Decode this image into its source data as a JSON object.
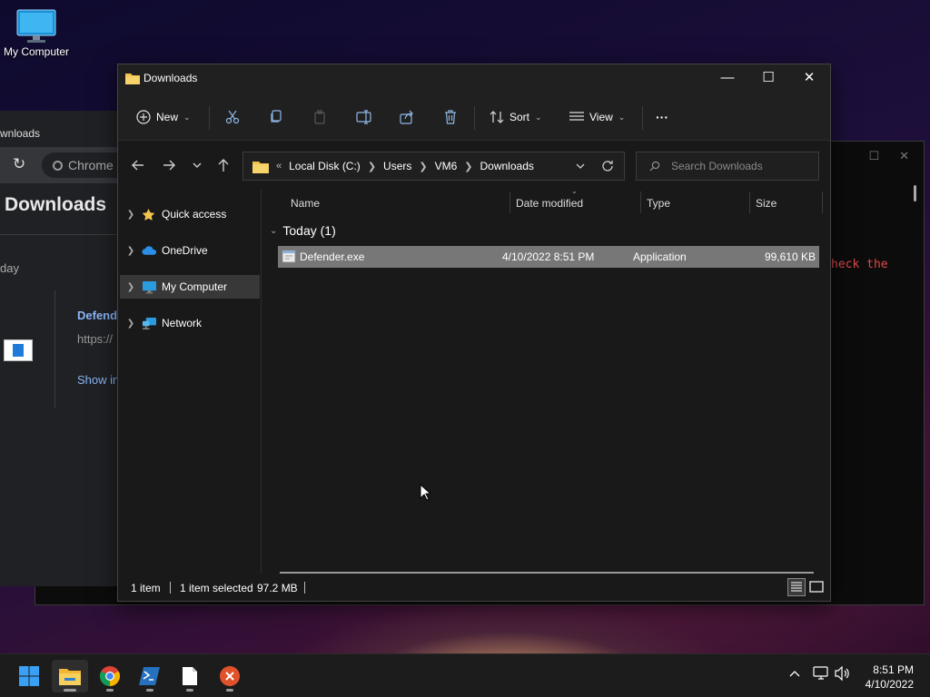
{
  "desktop": {
    "icon_label": "My Computer"
  },
  "terminal": {
    "visible_text": "heck the"
  },
  "chrome": {
    "tab_title": "wnloads",
    "omnibox_text": "Chrome",
    "heading": "Downloads",
    "day_label": "day",
    "file_name": "Defende",
    "file_url": "https://",
    "show_link": "Show in"
  },
  "explorer": {
    "title": "Downloads",
    "toolbar": {
      "new_label": "New",
      "sort_label": "Sort",
      "view_label": "View",
      "more_label": "···"
    },
    "address": {
      "overflow": "«",
      "segments": [
        "Local Disk (C:)",
        "Users",
        "VM6",
        "Downloads"
      ]
    },
    "search": {
      "placeholder": "Search Downloads"
    },
    "nav": [
      {
        "label": "Quick access",
        "icon": "star-icon",
        "selected": false
      },
      {
        "label": "OneDrive",
        "icon": "cloud-icon",
        "selected": false
      },
      {
        "label": "My Computer",
        "icon": "computer-icon",
        "selected": true
      },
      {
        "label": "Network",
        "icon": "network-icon",
        "selected": false
      }
    ],
    "columns": [
      "Name",
      "Date modified",
      "Type",
      "Size"
    ],
    "group": {
      "label": "Today (1)"
    },
    "files": [
      {
        "name": "Defender.exe",
        "date": "4/10/2022 8:51 PM",
        "type": "Application",
        "size": "99,610 KB"
      }
    ],
    "status": {
      "count": "1 item",
      "selected": "1 item selected",
      "size": "97.2 MB"
    }
  },
  "taskbar": {
    "apps": [
      "start-icon",
      "file-explorer-icon",
      "chrome-icon",
      "powershell-icon",
      "notepad-icon",
      "close-app-icon"
    ],
    "time": "8:51 PM",
    "date": "4/10/2022"
  },
  "colors": {
    "accent": "#0078d4",
    "selected_row": "#777777",
    "folder": "#f2c14e",
    "window_bg": "#191919"
  }
}
